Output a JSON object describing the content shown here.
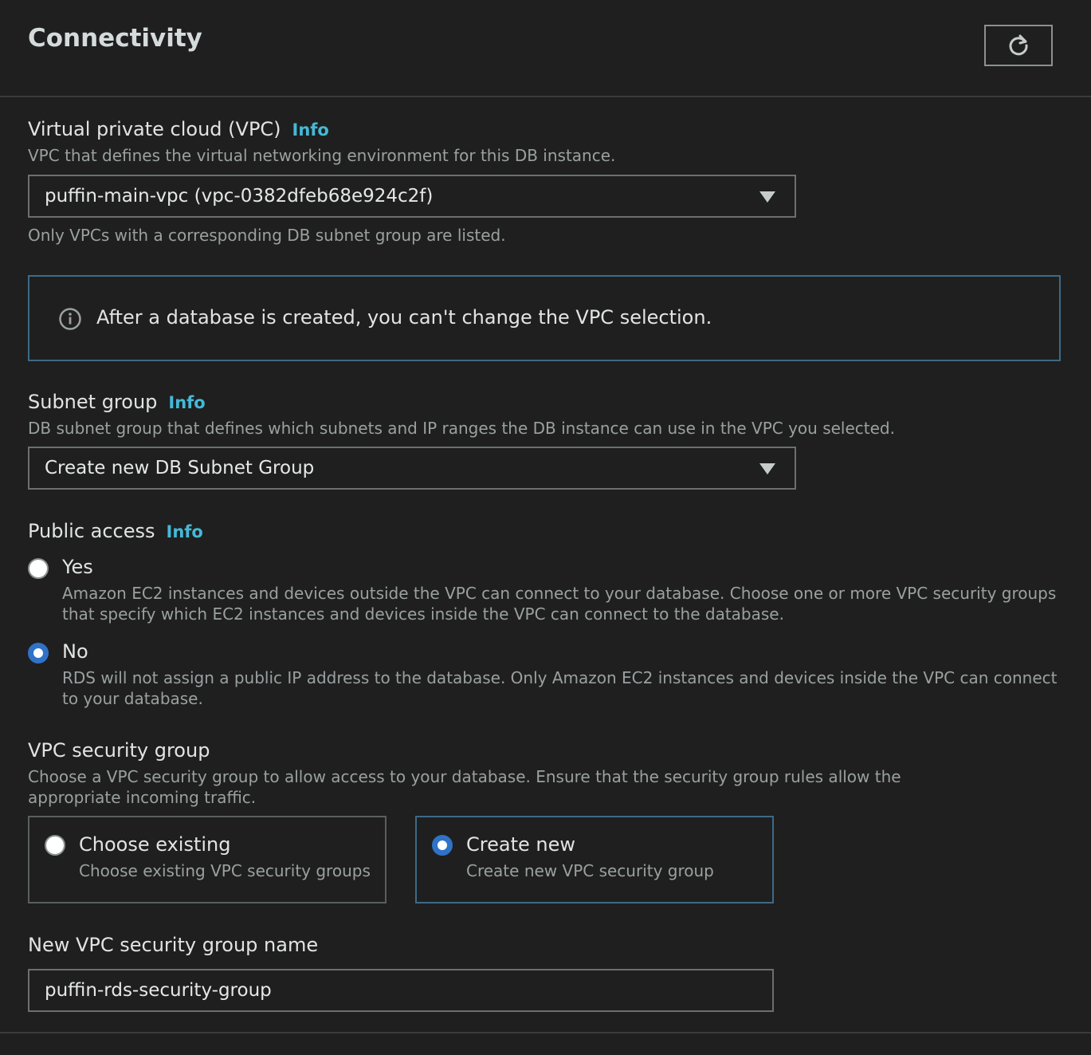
{
  "header": {
    "title": "Connectivity",
    "refresh_icon": "refresh-icon"
  },
  "vpc": {
    "label": "Virtual private cloud (VPC)",
    "info": "Info",
    "description": "VPC that defines the virtual networking environment for this DB instance.",
    "selected": "puffin-main-vpc (vpc-0382dfeb68e924c2f)",
    "hint": "Only VPCs with a corresponding DB subnet group are listed."
  },
  "alert": {
    "icon": "info-circle-icon",
    "message": "After a database is created, you can't change the VPC selection.",
    "border_color": "#3e6a86"
  },
  "subnet": {
    "label": "Subnet group",
    "info": "Info",
    "description": "DB subnet group that defines which subnets and IP ranges the DB instance can use in the VPC you selected.",
    "selected": "Create new DB Subnet Group"
  },
  "public_access": {
    "label": "Public access",
    "info": "Info",
    "options": [
      {
        "label": "Yes",
        "description": "Amazon EC2 instances and devices outside the VPC can connect to your database. Choose one or more VPC security groups that specify which EC2 instances and devices inside the VPC can connect to the database.",
        "selected": false
      },
      {
        "label": "No",
        "description": "RDS will not assign a public IP address to the database. Only Amazon EC2 instances and devices inside the VPC can connect to your database.",
        "selected": true
      }
    ]
  },
  "security_group": {
    "label": "VPC security group",
    "description": "Choose a VPC security group to allow access to your database. Ensure that the security group rules allow the appropriate incoming traffic.",
    "options": [
      {
        "label": "Choose existing",
        "description": "Choose existing VPC security groups",
        "selected": false
      },
      {
        "label": "Create new",
        "description": "Create new VPC security group",
        "selected": true
      }
    ]
  },
  "new_group_name": {
    "label": "New VPC security group name",
    "value": "puffin-rds-security-group"
  },
  "colors": {
    "background": "#1f1f1f",
    "info_link": "#44b9d6",
    "radio_selected": "#2f72c7"
  }
}
